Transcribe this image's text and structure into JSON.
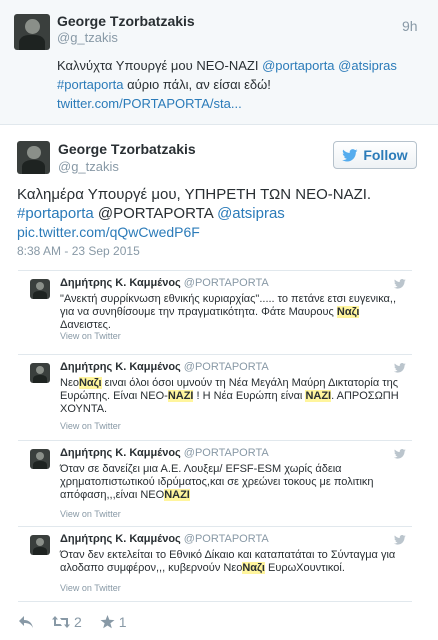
{
  "reply_tweet": {
    "author_name": "George Tzorbatzakis",
    "author_handle": "@g_tzakis",
    "timestamp": "9h",
    "line1_text": "Καλνύχτα Υπουργέ μου ΝΕΟ-ΝΑΖΙ ",
    "line1_mention1": "@portaporta",
    "line1_mention2": "@atsipras",
    "line2_hashtag": "#portaporta",
    "line2_text": " αύριο πάλι, αν είσαι εδώ!",
    "line3_link": "twitter.com/PORTAPORTA/sta..."
  },
  "main_tweet": {
    "author_name": "George Tzorbatzakis",
    "author_handle": "@g_tzakis",
    "follow_label": "Follow",
    "line1_text": "Καλημέρα Υπουργέ μου, ΥΠΗΡΕΤΗ ΤΩΝ ΝΕΟ-ΝΑΖΙ.",
    "line2_hashtag": "#portaporta",
    "line2_mention1": "@PORTAPORTA",
    "line2_mention2": "@atsipras",
    "line3_link": "pic.twitter.com/qQwCwedP6F",
    "timestamp": "8:38 AM - 23 Sep 2015",
    "retweet_count": "2",
    "like_count": "1"
  },
  "embedded_cards": [
    {
      "author": "Δημήτρης Κ. Καμμένος",
      "handle": "@PORTAPORTA",
      "text_parts": [
        "\"Ανεκτή συρρίκνωση εθνικής κυριαρχίας\"..... το πετάνε ετσι ευγενικα,, για να συνηθίσουμε την πραγματικότητα. Φάτε Μαυρους ",
        "Ναζι",
        " Δανειστες."
      ],
      "view_label": "View on Twitter"
    },
    {
      "author": "Δημήτρης Κ. Καμμένος",
      "handle": "@PORTAPORTA",
      "text_parts": [
        "Νεο",
        "Ναζι",
        " ειναι όλοι όσοι υμνούν τη Νέα Μεγάλη Μαύρη Δικτατορία της Ευρώπης. Είναι ΝΕΟ-",
        "ΝΑΖΙ",
        " ! Η Νέα Ευρώπη είναι ",
        "ΝΑΖΙ",
        ". ΑΠΡΟΣΩΠΗ ΧΟΥΝΤΑ."
      ],
      "view_label": "View on Twitter"
    },
    {
      "author": "Δημήτρης Κ. Καμμένος",
      "handle": "@PORTAPORTA",
      "text_parts": [
        "Όταν σε δανείζει μια Α.Ε. Λουξεμ/ EFSF-ESM χωρίς άδεια χρηματοπιστωτικού ιδρύματος,και σε χρεώνει τοκους με πολιτικη απόφαση,,,είναι ΝΕΟ",
        "ΝΑΖΙ",
        ""
      ],
      "view_label": "View on Twitter"
    },
    {
      "author": "Δημήτρης Κ. Καμμένος",
      "handle": "@PORTAPORTA",
      "text_parts": [
        "Όταν δεν εκτελείται το Εθνικό Δίκαιο και καταπατάται το Σύνταγμα για αλοδαπο συμφέρον,,, κυβερνούν Νεο",
        "Ναζι",
        " ΕυρωΧουντικοί."
      ],
      "view_label": "View on Twitter"
    }
  ],
  "colors": {
    "link": "#2b7bb9",
    "muted": "#8899a6",
    "text": "#292f33",
    "reply_bg": "#f5f8fa",
    "highlight": "#fff59d"
  },
  "icons": [
    "twitter-bird-icon",
    "reply-icon",
    "retweet-icon",
    "favorite-star-icon"
  ]
}
